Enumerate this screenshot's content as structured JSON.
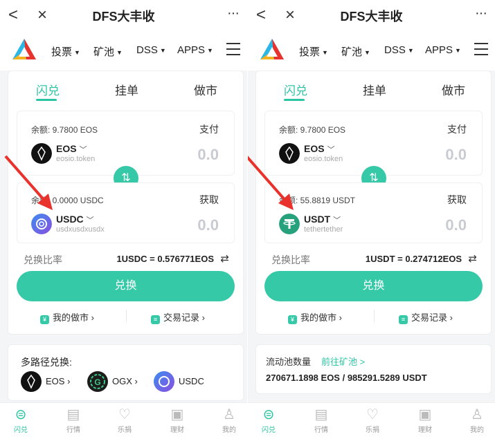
{
  "app": {
    "title": "DFS大丰收",
    "more": "···",
    "back": "<",
    "close": "×"
  },
  "nav": {
    "items": [
      "投票",
      "矿池",
      "DSS",
      "APPS"
    ]
  },
  "tabs": [
    "闪兑",
    "挂单",
    "做市"
  ],
  "left": {
    "pay": {
      "balance": "余额: 9.7800 EOS",
      "label": "支付",
      "token": "EOS",
      "contract": "eosio.token",
      "amount": "0.0"
    },
    "get": {
      "balance": "余额: 0.0000 USDC",
      "label": "获取",
      "token": "USDC",
      "contract": "usdxusdxusdx",
      "amount": "0.0"
    },
    "rate_label": "兑换比率",
    "rate_value": "1USDC = 0.576771EOS",
    "swap_button": "兑换",
    "my_market": "我的做市",
    "records": "交易记录",
    "multi": {
      "title": "多路径兑换:",
      "path": [
        "EOS",
        "OGX",
        "USDC"
      ]
    }
  },
  "right": {
    "pay": {
      "balance": "余额: 9.7800 EOS",
      "label": "支付",
      "token": "EOS",
      "contract": "eosio.token",
      "amount": "0.0"
    },
    "get": {
      "balance": "余额: 55.8819 USDT",
      "label": "获取",
      "token": "USDT",
      "contract": "tethertether",
      "amount": "0.0"
    },
    "rate_label": "兑换比率",
    "rate_value": "1USDT = 0.274712EOS",
    "swap_button": "兑换",
    "my_market": "我的做市",
    "records": "交易记录",
    "pool": {
      "label": "流动池数量",
      "link": "前往矿池 >",
      "value": "270671.1898 EOS / 985291.5289 USDT"
    }
  },
  "bottom": [
    "闪兑",
    "行情",
    "乐捐",
    "理财",
    "我的"
  ],
  "colors": {
    "accent": "#35c9a8",
    "arrow": "#e8322b",
    "usdt": "#26a17b",
    "usdc": "#5b6ee1"
  }
}
